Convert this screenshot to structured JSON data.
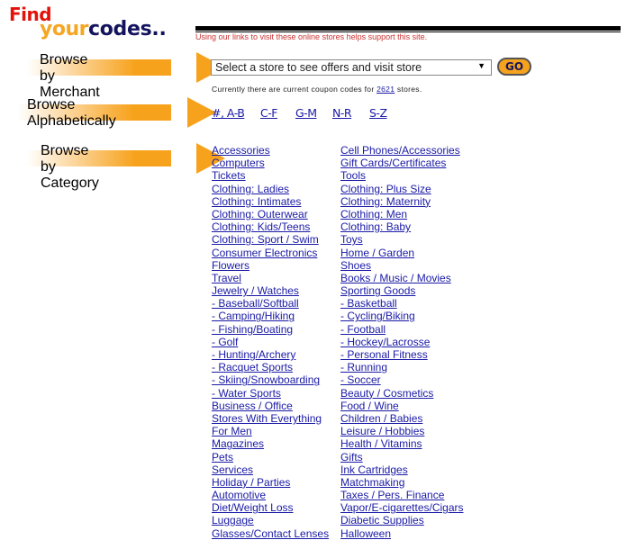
{
  "logo": {
    "line1": "Find",
    "line2a": "your",
    "line2b": "codes.."
  },
  "header": {
    "support_text": "Using our links to visit these online stores helps support this site."
  },
  "sections": {
    "merchant": "Browse by Merchant",
    "alphabet": "Browse Alphabetically",
    "category": "Browse by Category"
  },
  "merchant": {
    "select_value": "Select a store to see offers and visit store",
    "go_label": "GO",
    "count_prefix": "Currently there are current coupon codes for",
    "count_value": "2621",
    "count_suffix": "stores."
  },
  "alphabet_links": [
    "#, A-B",
    "C-F",
    "G-M",
    "N-R",
    "S-Z"
  ],
  "categories": {
    "left": [
      "Accessories",
      "Computers",
      "Tickets",
      "Clothing: Ladies",
      "Clothing: Intimates",
      "Clothing: Outerwear",
      "Clothing: Kids/Teens",
      "Clothing: Sport / Swim",
      "Consumer Electronics",
      "Flowers",
      "Travel",
      "Jewelry / Watches",
      "- Baseball/Softball",
      "- Camping/Hiking",
      "- Fishing/Boating",
      "- Golf",
      "- Hunting/Archery",
      "- Racquet Sports",
      "- Skiing/Snowboarding",
      "- Water Sports",
      "Business / Office",
      "Stores With Everything",
      "For Men",
      "Magazines",
      "Pets",
      "Services",
      "Holiday / Parties",
      "Automotive",
      "Diet/Weight Loss",
      "Luggage",
      "Glasses/Contact Lenses"
    ],
    "right": [
      "Cell Phones/Accessories",
      "Gift Cards/Certificates",
      "Tools",
      "Clothing: Plus Size",
      "Clothing: Maternity",
      "Clothing: Men",
      "Clothing: Baby",
      "Toys",
      "Home / Garden",
      "Shoes",
      "Books / Music / Movies",
      "Sporting Goods",
      "- Basketball",
      "- Cycling/Biking",
      "- Football",
      "- Hockey/Lacrosse",
      "- Personal Fitness",
      "- Running",
      "- Soccer",
      "Beauty / Cosmetics",
      "Food / Wine",
      "Children / Babies",
      "Leisure / Hobbies",
      "Health / Vitamins",
      "Gifts",
      "Ink Cartridges",
      "Matchmaking",
      "Taxes / Pers. Finance",
      "Vapor/E-cigarettes/Cigars",
      "Diabetic Supplies",
      "Halloween"
    ]
  }
}
